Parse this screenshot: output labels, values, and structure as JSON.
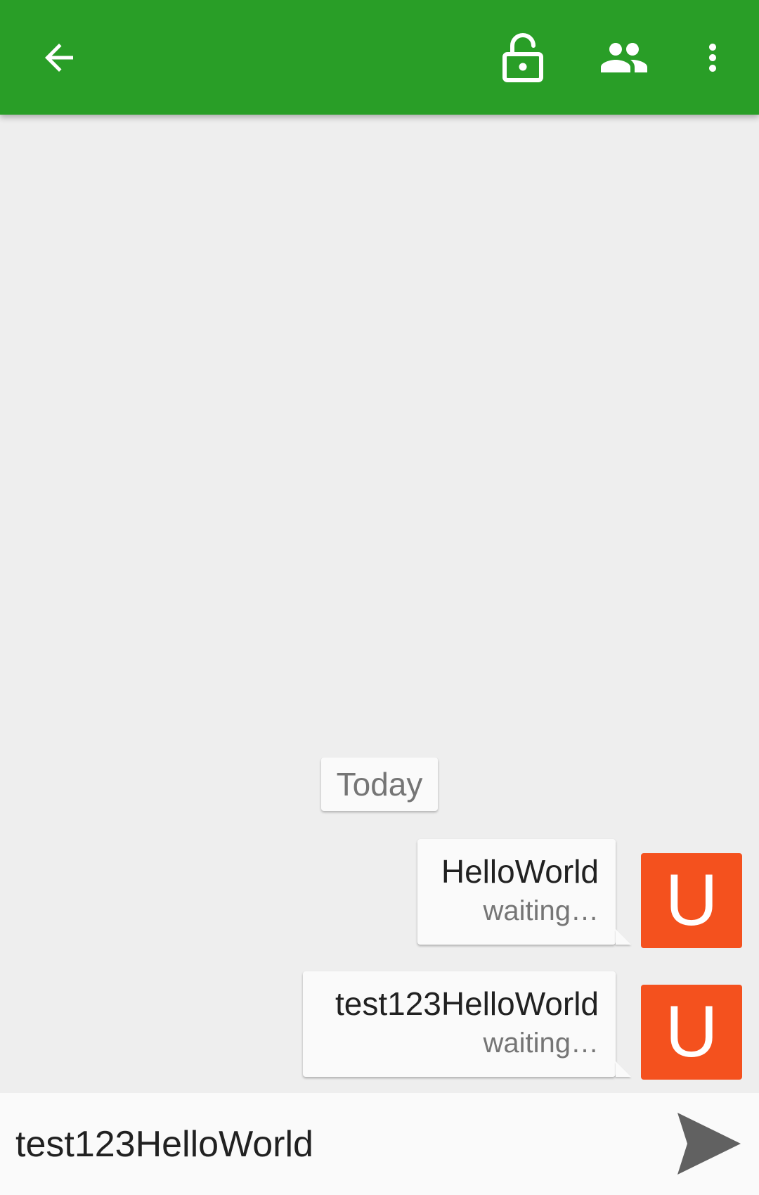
{
  "colors": {
    "appbar": "#299e27",
    "background": "#eeeeee",
    "avatar": "#f4511e",
    "bubble": "#fafafa",
    "send_icon": "#616161"
  },
  "appbar": {
    "back_icon": "arrow-left-icon",
    "lock_icon": "lock-open-icon",
    "people_icon": "people-icon",
    "more_icon": "more-vert-icon"
  },
  "conversation": {
    "date_separator": "Today",
    "messages": [
      {
        "text": "HelloWorld",
        "status": "waiting…",
        "avatar_letter": "U"
      },
      {
        "text": "test123HelloWorld",
        "status": "waiting…",
        "avatar_letter": "U"
      }
    ]
  },
  "compose": {
    "value": "test123HelloWorld",
    "send_icon": "send-icon"
  }
}
